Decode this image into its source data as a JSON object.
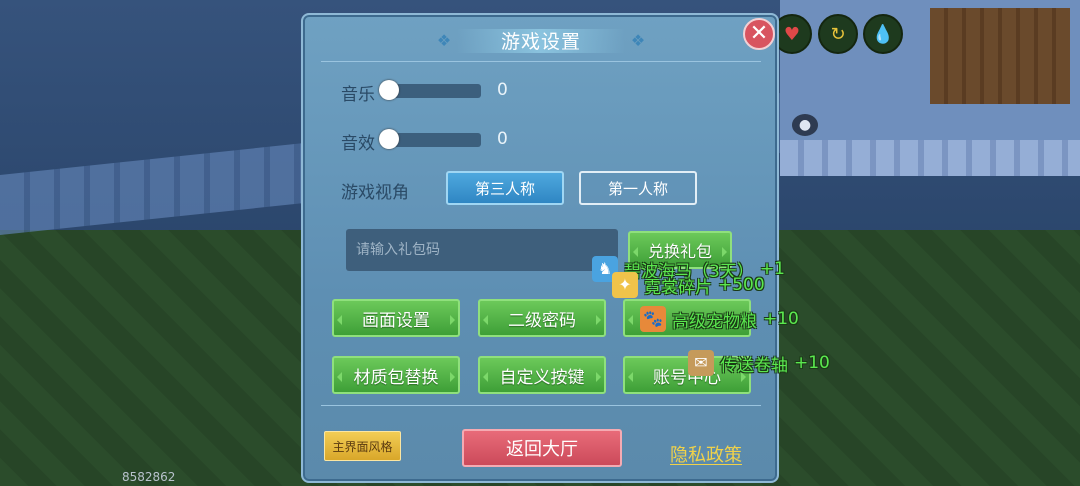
{
  "dialog": {
    "title": "游戏设置",
    "close_icon": "close-icon"
  },
  "music": {
    "label": "音乐",
    "value": "0",
    "level": 0
  },
  "sound": {
    "label": "音效",
    "value": "0",
    "level": 0
  },
  "view": {
    "label": "游戏视角",
    "options": [
      {
        "label": "第三人称",
        "selected": true
      },
      {
        "label": "第一人称",
        "selected": false
      }
    ]
  },
  "gift": {
    "placeholder": "请输入礼包码",
    "value": "",
    "redeem_label": "兑换礼包"
  },
  "buttons": {
    "graphics": "画面设置",
    "second_password": "二级密码",
    "other": "",
    "texture_pack": "材质包替换",
    "custom_keys": "自定义按键",
    "account": "账号中心"
  },
  "footer": {
    "main_style": "主界面风格",
    "back_lobby": "返回大厅",
    "privacy": "隐私政策"
  },
  "rewards": [
    {
      "name": "碧波海马（3天）",
      "amount": "+1",
      "icon": "seahorse-icon"
    },
    {
      "name": "霓裳碎片",
      "amount": "+500",
      "icon": "shard-icon"
    },
    {
      "name": "高级宠物粮",
      "amount": "+10",
      "icon": "pet-food-icon"
    },
    {
      "name": "传送卷轴",
      "amount": "+10",
      "icon": "scroll-icon"
    }
  ],
  "player_id": "8582862",
  "hud": {
    "icons": [
      "heart-icon",
      "arrow-icon",
      "water-drop-icon"
    ]
  },
  "colors": {
    "accent_green": "#5be84f",
    "lobby_red": "#cc4a5a",
    "privacy_yellow": "#f0d24a"
  }
}
